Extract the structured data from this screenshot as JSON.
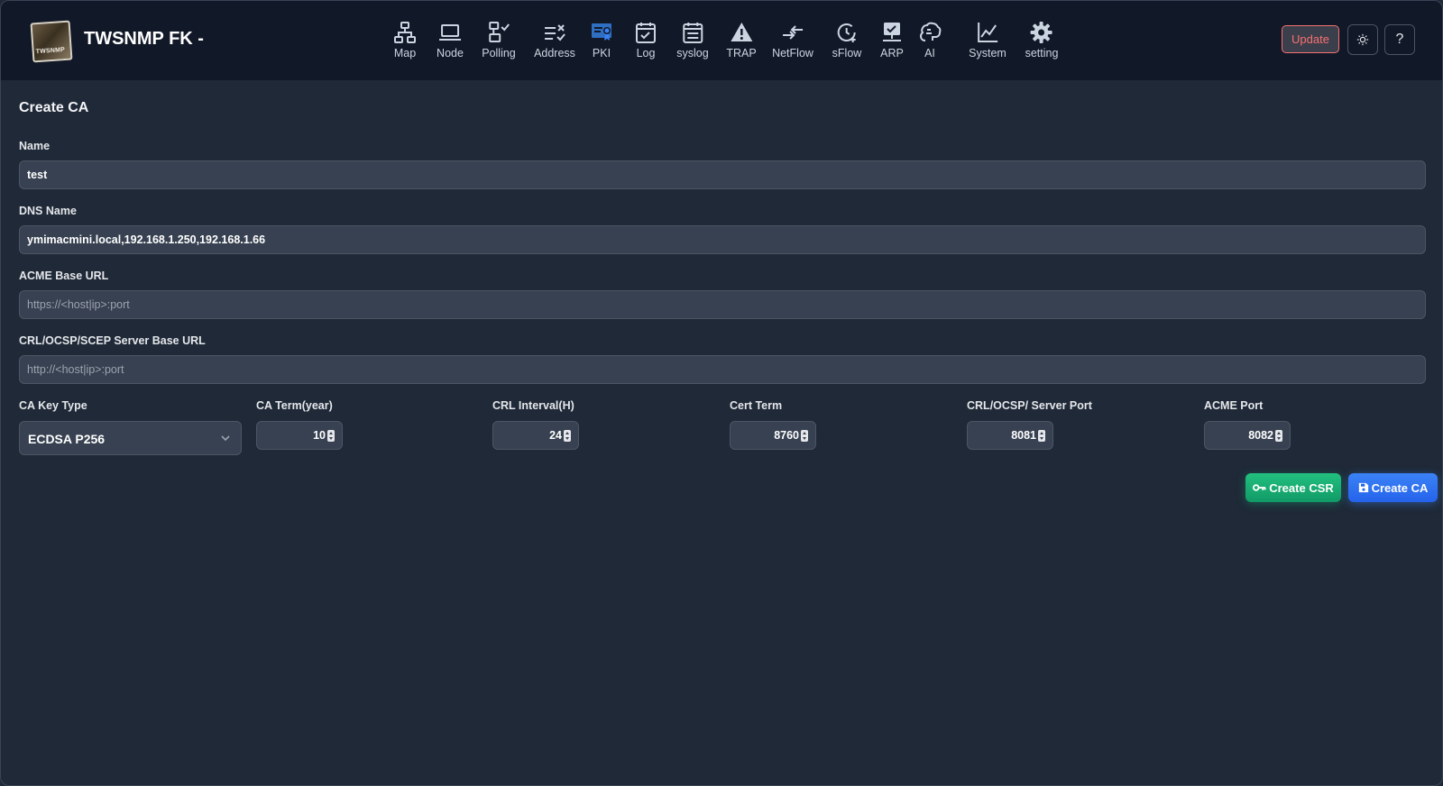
{
  "header": {
    "logo_text": "TWSNMP",
    "app_title": "TWSNMP FK -",
    "update_label": "Update",
    "help_label": "?",
    "nav": [
      {
        "label": "Map",
        "icon": "network-icon"
      },
      {
        "label": "Node",
        "icon": "laptop-icon"
      },
      {
        "label": "Polling",
        "icon": "polling-icon"
      },
      {
        "label": "Address",
        "icon": "address-check-icon"
      },
      {
        "label": "PKI",
        "icon": "certificate-icon",
        "active": true
      },
      {
        "label": "Log",
        "icon": "calendar-check-icon"
      },
      {
        "label": "syslog",
        "icon": "calendar-list-icon"
      },
      {
        "label": "TRAP",
        "icon": "warning-icon"
      },
      {
        "label": "NetFlow",
        "icon": "arrows-exchange-icon"
      },
      {
        "label": "sFlow",
        "icon": "clock-icon"
      },
      {
        "label": "ARP",
        "icon": "monitor-check-icon"
      },
      {
        "label": "AI",
        "icon": "brain-icon"
      },
      {
        "label": "System",
        "icon": "line-chart-icon"
      },
      {
        "label": "setting",
        "icon": "gear-icon"
      }
    ]
  },
  "form": {
    "title": "Create CA",
    "name_label": "Name",
    "name_value": "test",
    "dns_label": "DNS Name",
    "dns_value": "ymimacmini.local,192.168.1.250,192.168.1.66",
    "acme_url_label": "ACME Base URL",
    "acme_url_placeholder": "https://<host|ip>:port",
    "crl_url_label": "CRL/OCSP/SCEP Server Base URL",
    "crl_url_placeholder": "http://<host|ip>:port",
    "key_type_label": "CA Key Type",
    "key_type_value": "ECDSA P256",
    "ca_term_label": "CA Term(year)",
    "ca_term_value": "10",
    "crl_interval_label": "CRL Interval(H)",
    "crl_interval_value": "24",
    "cert_term_label": "Cert Term",
    "cert_term_value": "8760",
    "server_port_label": "CRL/OCSP/ Server Port",
    "server_port_value": "8081",
    "acme_port_label": "ACME Port",
    "acme_port_value": "8082"
  },
  "actions": {
    "create_csr_label": "Create CSR",
    "create_ca_label": "Create CA"
  },
  "colors": {
    "accent_blue": "#3b82f6",
    "accent_green": "#10b981",
    "update_red": "#f87171",
    "active_nav": "#3b82f6"
  }
}
